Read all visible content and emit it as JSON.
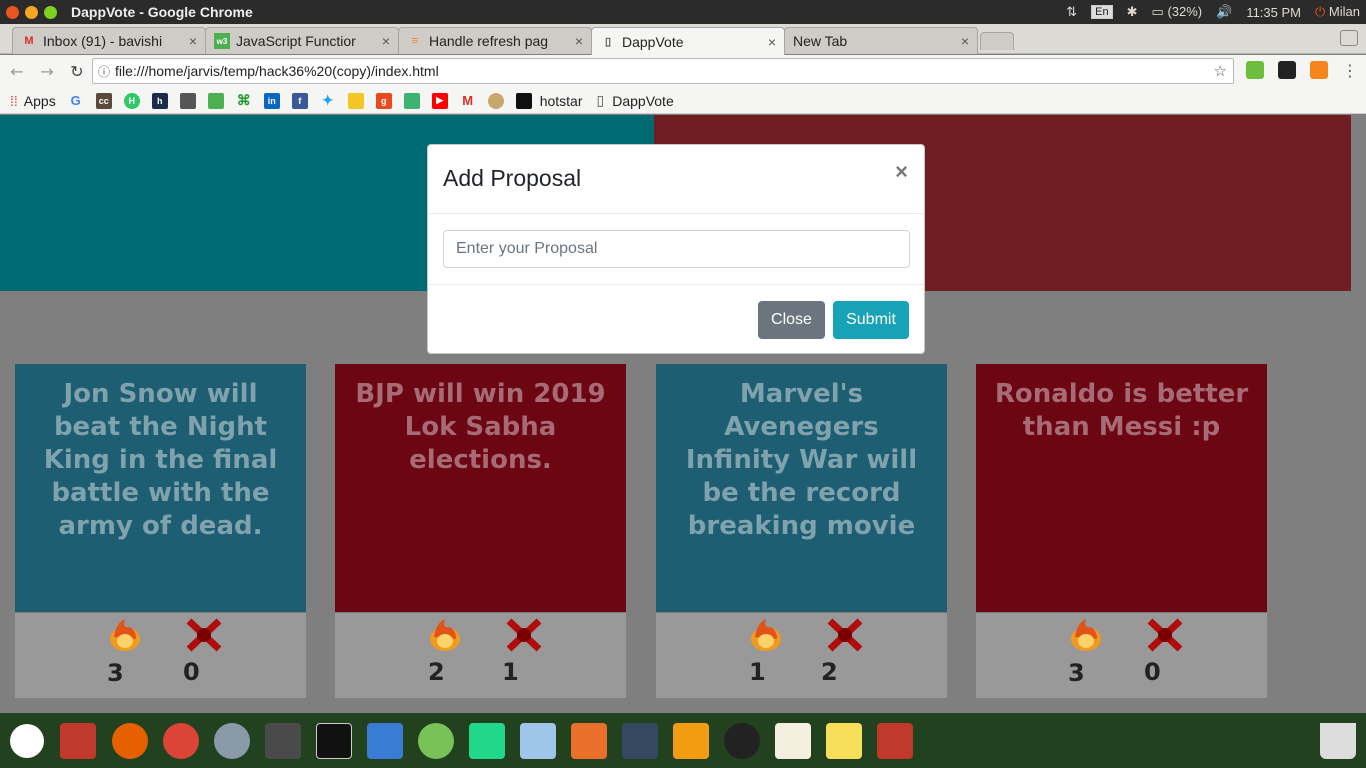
{
  "os_bar": {
    "window_title": "DappVote - Google Chrome",
    "keyboard": "En",
    "battery": "(32%)",
    "time": "11:35 PM",
    "user": "Milan"
  },
  "tabs": [
    {
      "label": "Inbox (91) - bavishi",
      "favicon": "gmail-icon"
    },
    {
      "label": "JavaScript Functior",
      "favicon": "w3-icon"
    },
    {
      "label": "Handle refresh pag",
      "favicon": "stackoverflow-icon"
    },
    {
      "label": "DappVote",
      "favicon": "page-icon"
    },
    {
      "label": "New Tab",
      "favicon": ""
    }
  ],
  "tab_close": "×",
  "address": "file:///home/jarvis/temp/hack36%20(copy)/index.html",
  "bookmarks": {
    "apps": "Apps",
    "hotstar": "hotstar",
    "dappvote": "DappVote"
  },
  "modal": {
    "title": "Add Proposal",
    "close_x": "×",
    "placeholder": "Enter your Proposal",
    "close_button": "Close",
    "submit_button": "Submit"
  },
  "proposals": [
    {
      "text": "Jon Snow will beat the Night King in the final battle with the army of dead.",
      "up": "3",
      "down": "0"
    },
    {
      "text": "BJP will win 2019 Lok Sabha elections.",
      "up": "2",
      "down": "1"
    },
    {
      "text": "Marvel's Avenegers Infinity War will be the record breaking movie",
      "up": "1",
      "down": "2"
    },
    {
      "text": "Ronaldo is better than Messi :p",
      "up": "3",
      "down": "0"
    }
  ],
  "colors": {
    "card_blue": "#1d5e72",
    "card_red": "#6b0612",
    "submit": "#17a2b8",
    "close": "#6c757d"
  }
}
